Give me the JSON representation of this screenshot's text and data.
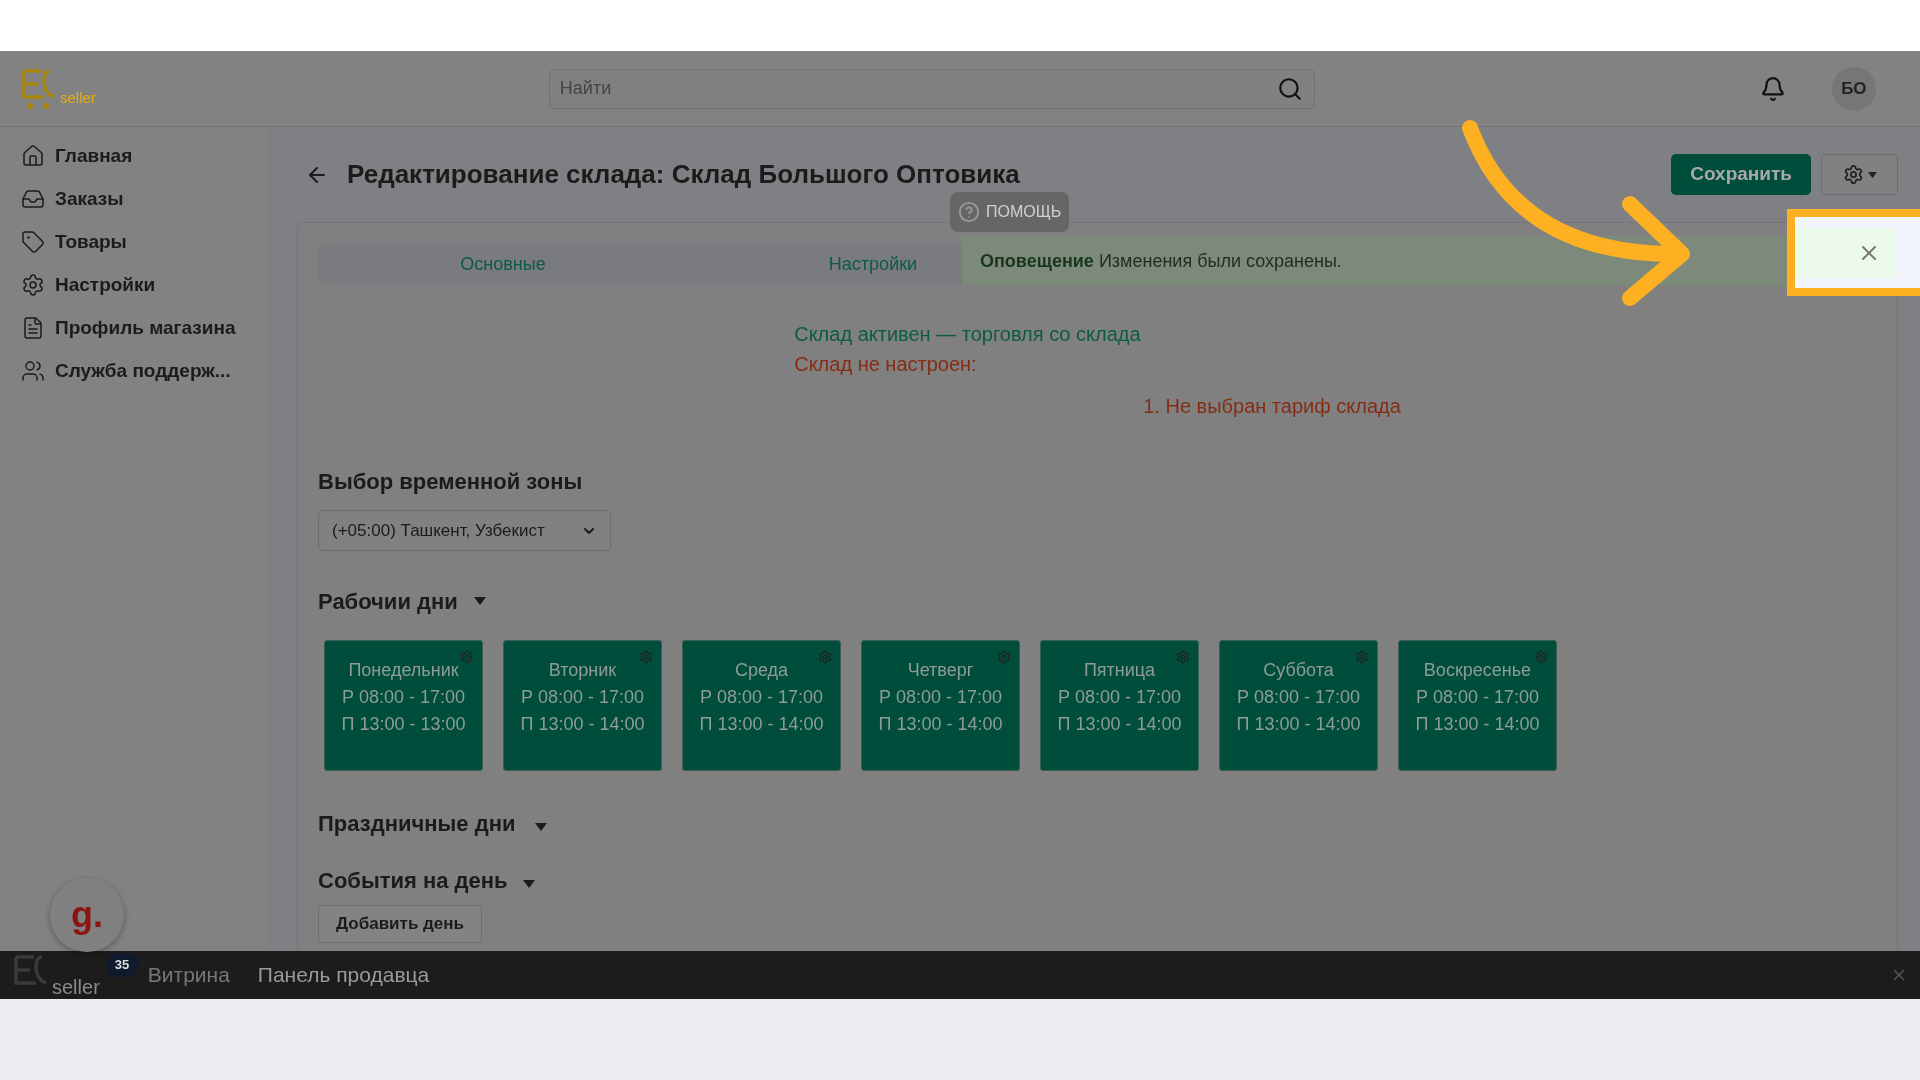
{
  "header": {
    "logo_text": "seller",
    "search": {
      "placeholder": "Найти"
    },
    "avatar": "БО"
  },
  "sidebar": {
    "items": [
      {
        "label": "Главная"
      },
      {
        "label": "Заказы"
      },
      {
        "label": "Товары"
      },
      {
        "label": "Настройки"
      },
      {
        "label": "Профиль магазина"
      },
      {
        "label": "Служба поддерж..."
      }
    ]
  },
  "page": {
    "title": "Редактирование склада: Склад Большого Оптовика",
    "save_button": "Сохранить",
    "tabs": [
      {
        "label": "Основные"
      },
      {
        "label": "Настройки"
      }
    ],
    "status": {
      "active": "Склад активен — торговля со склада",
      "not_configured": "Склад не настроен:",
      "issues": [
        "1. Не выбран тариф склада"
      ]
    },
    "timezone": {
      "heading": "Выбор временной зоны",
      "value": "(+05:00) Ташкент, Узбекист"
    },
    "working_days": {
      "heading": "Рабочии дни",
      "days": [
        {
          "name": "Понедельник",
          "work": "Р 08:00 - 17:00",
          "break": "П 13:00 - 13:00"
        },
        {
          "name": "Вторник",
          "work": "Р 08:00 - 17:00",
          "break": "П 13:00 - 14:00"
        },
        {
          "name": "Среда",
          "work": "Р 08:00 - 17:00",
          "break": "П 13:00 - 14:00"
        },
        {
          "name": "Четверг",
          "work": "Р 08:00 - 17:00",
          "break": "П 13:00 - 14:00"
        },
        {
          "name": "Пятница",
          "work": "Р 08:00 - 17:00",
          "break": "П 13:00 - 14:00"
        },
        {
          "name": "Суббота",
          "work": "Р 08:00 - 17:00",
          "break": "П 13:00 - 14:00"
        },
        {
          "name": "Воскресенье",
          "work": "Р 08:00 - 17:00",
          "break": "П 13:00 - 14:00"
        }
      ]
    },
    "holidays": {
      "heading": "Праздничные дни"
    },
    "events": {
      "heading": "События на день",
      "add_button": "Добавить день"
    }
  },
  "help_button": "ПОМОЩЬ",
  "toast": {
    "title": "Оповещение",
    "message": "Изменения были сохранены."
  },
  "recorder": {
    "letter": "g.",
    "badge": "35"
  },
  "bottom_bar": {
    "logo_text": "seller",
    "links": [
      "Витрина",
      "Панель продавца"
    ]
  }
}
